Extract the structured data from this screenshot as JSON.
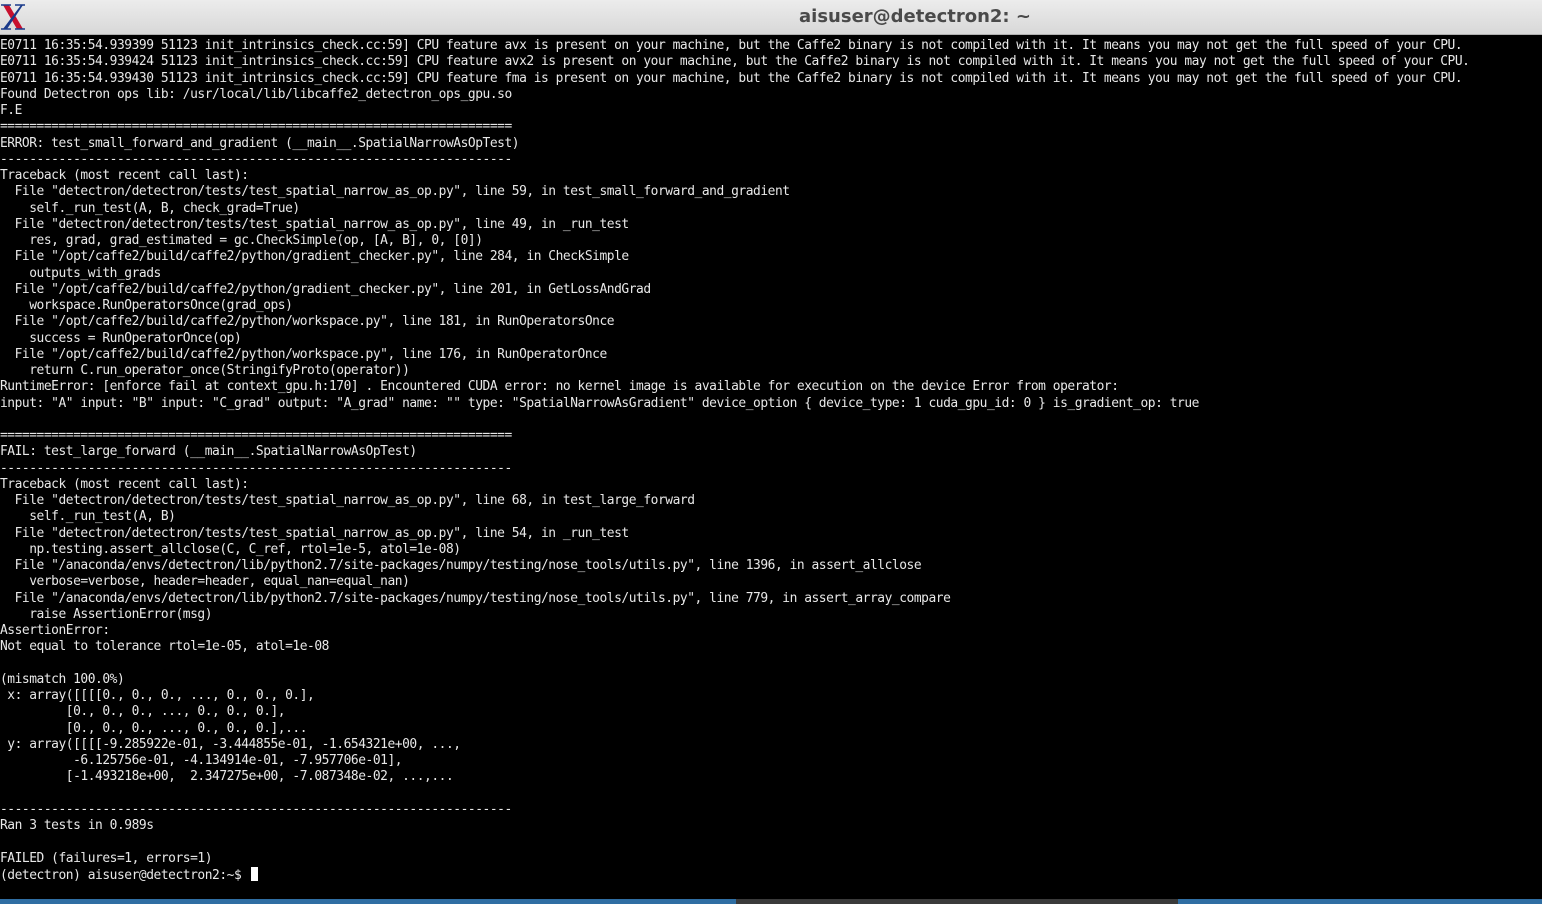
{
  "window": {
    "title": "aisuser@detectron2: ~",
    "app_icon": "x-window-icon"
  },
  "terminal": {
    "lines": [
      "E0711 16:35:54.939399 51123 init_intrinsics_check.cc:59] CPU feature avx is present on your machine, but the Caffe2 binary is not compiled with it. It means you may not get the full speed of your CPU.",
      "E0711 16:35:54.939424 51123 init_intrinsics_check.cc:59] CPU feature avx2 is present on your machine, but the Caffe2 binary is not compiled with it. It means you may not get the full speed of your CPU.",
      "E0711 16:35:54.939430 51123 init_intrinsics_check.cc:59] CPU feature fma is present on your machine, but the Caffe2 binary is not compiled with it. It means you may not get the full speed of your CPU.",
      "Found Detectron ops lib: /usr/local/lib/libcaffe2_detectron_ops_gpu.so",
      "F.E",
      "======================================================================",
      "ERROR: test_small_forward_and_gradient (__main__.SpatialNarrowAsOpTest)",
      "----------------------------------------------------------------------",
      "Traceback (most recent call last):",
      "  File \"detectron/detectron/tests/test_spatial_narrow_as_op.py\", line 59, in test_small_forward_and_gradient",
      "    self._run_test(A, B, check_grad=True)",
      "  File \"detectron/detectron/tests/test_spatial_narrow_as_op.py\", line 49, in _run_test",
      "    res, grad, grad_estimated = gc.CheckSimple(op, [A, B], 0, [0])",
      "  File \"/opt/caffe2/build/caffe2/python/gradient_checker.py\", line 284, in CheckSimple",
      "    outputs_with_grads",
      "  File \"/opt/caffe2/build/caffe2/python/gradient_checker.py\", line 201, in GetLossAndGrad",
      "    workspace.RunOperatorsOnce(grad_ops)",
      "  File \"/opt/caffe2/build/caffe2/python/workspace.py\", line 181, in RunOperatorsOnce",
      "    success = RunOperatorOnce(op)",
      "  File \"/opt/caffe2/build/caffe2/python/workspace.py\", line 176, in RunOperatorOnce",
      "    return C.run_operator_once(StringifyProto(operator))",
      "RuntimeError: [enforce fail at context_gpu.h:170] . Encountered CUDA error: no kernel image is available for execution on the device Error from operator:",
      "input: \"A\" input: \"B\" input: \"C_grad\" output: \"A_grad\" name: \"\" type: \"SpatialNarrowAsGradient\" device_option { device_type: 1 cuda_gpu_id: 0 } is_gradient_op: true",
      "",
      "======================================================================",
      "FAIL: test_large_forward (__main__.SpatialNarrowAsOpTest)",
      "----------------------------------------------------------------------",
      "Traceback (most recent call last):",
      "  File \"detectron/detectron/tests/test_spatial_narrow_as_op.py\", line 68, in test_large_forward",
      "    self._run_test(A, B)",
      "  File \"detectron/detectron/tests/test_spatial_narrow_as_op.py\", line 54, in _run_test",
      "    np.testing.assert_allclose(C, C_ref, rtol=1e-5, atol=1e-08)",
      "  File \"/anaconda/envs/detectron/lib/python2.7/site-packages/numpy/testing/nose_tools/utils.py\", line 1396, in assert_allclose",
      "    verbose=verbose, header=header, equal_nan=equal_nan)",
      "  File \"/anaconda/envs/detectron/lib/python2.7/site-packages/numpy/testing/nose_tools/utils.py\", line 779, in assert_array_compare",
      "    raise AssertionError(msg)",
      "AssertionError:",
      "Not equal to tolerance rtol=1e-05, atol=1e-08",
      "",
      "(mismatch 100.0%)",
      " x: array([[[[0., 0., 0., ..., 0., 0., 0.],",
      "         [0., 0., 0., ..., 0., 0., 0.],",
      "         [0., 0., 0., ..., 0., 0., 0.],...",
      " y: array([[[[-9.285922e-01, -3.444855e-01, -1.654321e+00, ...,",
      "          -6.125756e-01, -4.134914e-01, -7.957706e-01],",
      "         [-1.493218e+00,  2.347275e+00, -7.087348e-02, ...,...",
      "",
      "----------------------------------------------------------------------",
      "Ran 3 tests in 0.989s",
      "",
      "FAILED (failures=1, errors=1)"
    ],
    "prompt": "(detectron) aisuser@detectron2:~$ "
  }
}
